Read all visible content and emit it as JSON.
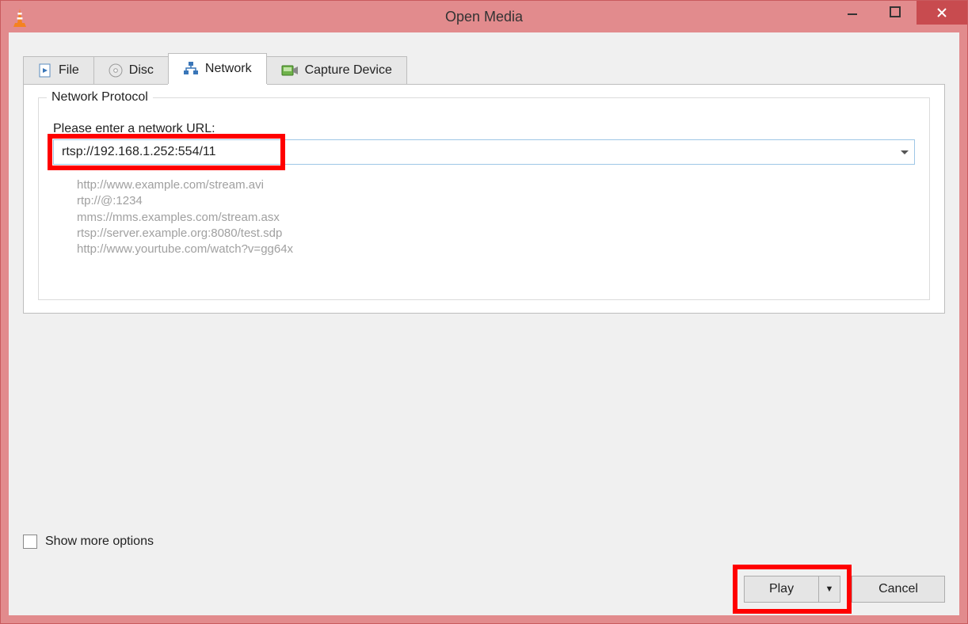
{
  "window": {
    "title": "Open Media"
  },
  "tabs": {
    "file": {
      "label": "File"
    },
    "disc": {
      "label": "Disc"
    },
    "network": {
      "label": "Network"
    },
    "capture": {
      "label": "Capture Device"
    }
  },
  "network_panel": {
    "group_title": "Network Protocol",
    "url_label": "Please enter a network URL:",
    "url_value": "rtsp://192.168.1.252:554/11",
    "examples": {
      "l1": "http://www.example.com/stream.avi",
      "l2": "rtp://@:1234",
      "l3": "mms://mms.examples.com/stream.asx",
      "l4": "rtsp://server.example.org:8080/test.sdp",
      "l5": "http://www.yourtube.com/watch?v=gg64x"
    }
  },
  "options": {
    "show_more_label": "Show more options"
  },
  "buttons": {
    "play": "Play",
    "cancel": "Cancel"
  }
}
